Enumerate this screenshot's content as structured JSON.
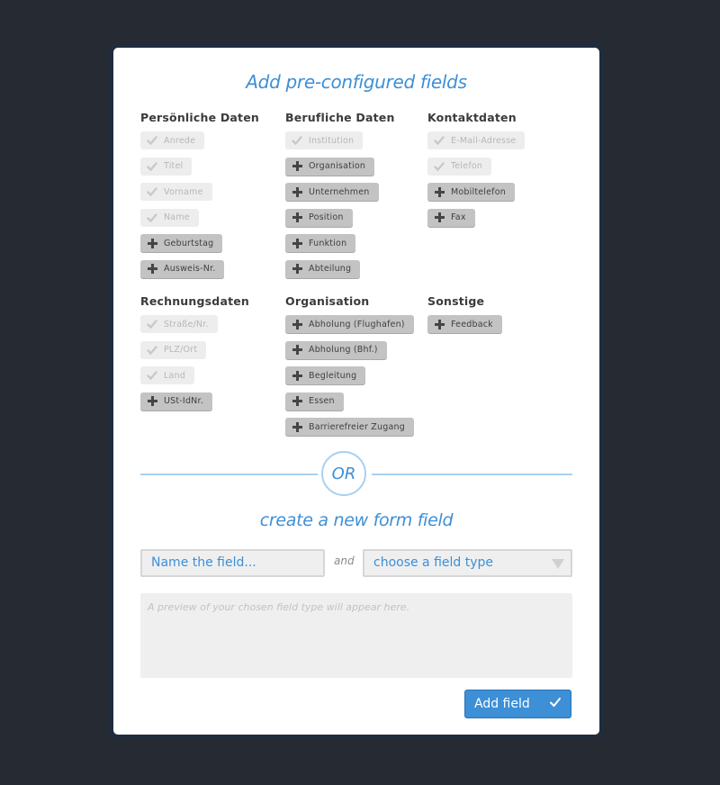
{
  "title": "Add pre-configured fields",
  "groups": [
    {
      "heading": "Persönliche Daten",
      "items": [
        {
          "label": "Anrede",
          "state": "added"
        },
        {
          "label": "Titel",
          "state": "added"
        },
        {
          "label": "Vorname",
          "state": "added"
        },
        {
          "label": "Name",
          "state": "added"
        },
        {
          "label": "Geburtstag",
          "state": "available"
        },
        {
          "label": "Ausweis-Nr.",
          "state": "available"
        }
      ]
    },
    {
      "heading": "Berufliche Daten",
      "items": [
        {
          "label": "Institution",
          "state": "added"
        },
        {
          "label": "Organisation",
          "state": "available"
        },
        {
          "label": "Unternehmen",
          "state": "available"
        },
        {
          "label": "Position",
          "state": "available"
        },
        {
          "label": "Funktion",
          "state": "available"
        },
        {
          "label": "Abteilung",
          "state": "available"
        }
      ]
    },
    {
      "heading": "Kontaktdaten",
      "items": [
        {
          "label": "E-Mail-Adresse",
          "state": "added"
        },
        {
          "label": "Telefon",
          "state": "added"
        },
        {
          "label": "Mobiltelefon",
          "state": "available"
        },
        {
          "label": "Fax",
          "state": "available"
        }
      ]
    },
    {
      "heading": "Rechnungsdaten",
      "items": [
        {
          "label": "Straße/Nr.",
          "state": "added"
        },
        {
          "label": "PLZ/Ort",
          "state": "added"
        },
        {
          "label": "Land",
          "state": "added"
        },
        {
          "label": "USt-IdNr.",
          "state": "available"
        }
      ]
    },
    {
      "heading": "Organisation",
      "items": [
        {
          "label": "Abholung (Flughafen)",
          "state": "available"
        },
        {
          "label": "Abholung (Bhf.)",
          "state": "available"
        },
        {
          "label": "Begleitung",
          "state": "available"
        },
        {
          "label": "Essen",
          "state": "available"
        },
        {
          "label": "Barrierefreier Zugang",
          "state": "available"
        }
      ]
    },
    {
      "heading": "Sonstige",
      "items": [
        {
          "label": "Feedback",
          "state": "available"
        }
      ]
    }
  ],
  "or_label": "OR",
  "subtitle": "create a new form field",
  "name_field": {
    "placeholder": "Name the field..."
  },
  "and_label": "and",
  "type_select": {
    "selected": "choose a field type"
  },
  "preview_text": "A preview of your chosen field type will appear here.",
  "add_button": {
    "label": "Add field"
  },
  "colors": {
    "accent": "#3d8fd6",
    "background": "#262a33",
    "chip_added": "#ededed",
    "chip_available": "#c3c3c3"
  }
}
